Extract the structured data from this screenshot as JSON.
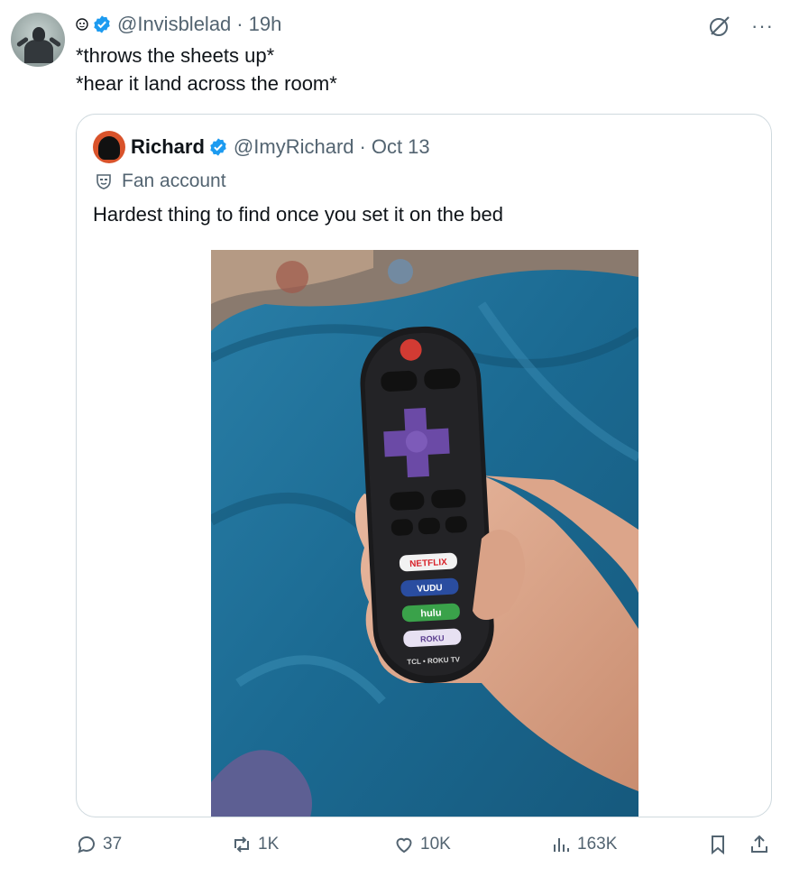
{
  "tweet": {
    "handle": "@Invisblelad",
    "separator": "·",
    "time": "19h",
    "text_line1": "*throws the sheets up*",
    "text_line2": "*hear it land across the room*"
  },
  "quoted_tweet": {
    "name": "Richard",
    "handle": "@ImyRichard",
    "separator": "·",
    "date": "Oct 13",
    "label": "Fan account",
    "text": "Hardest thing to find once you set it on the bed",
    "photo": {
      "remote_buttons": {
        "netflix": "NETFLIX",
        "vudu": "VUDU",
        "hulu": "hulu",
        "roku": "ROKU",
        "brand": "TCL • ROKU TV"
      }
    }
  },
  "actions": {
    "replies": "37",
    "reposts": "1K",
    "likes": "10K",
    "views": "163K"
  },
  "colors": {
    "verified": "#1d9bf0",
    "secondary_text": "#536471",
    "sheet_blue": "#1f6f97"
  },
  "icons": [
    "status-icon",
    "verified-badge-icon",
    "grok-icon",
    "more-icon",
    "mask-icon",
    "reply-icon",
    "repost-icon",
    "like-icon",
    "views-icon",
    "bookmark-icon",
    "share-icon"
  ]
}
